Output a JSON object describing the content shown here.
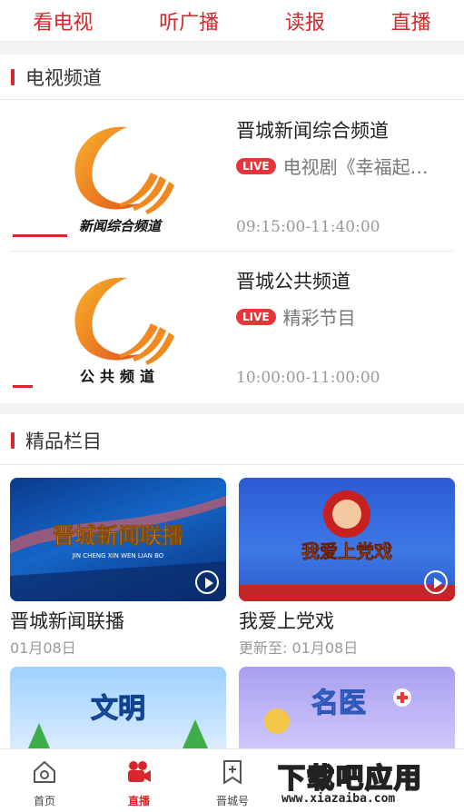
{
  "top_tabs": [
    "看电视",
    "听广播",
    "读报",
    "直播"
  ],
  "sections": {
    "tv_channels": "电视频道",
    "premium_columns": "精品栏目"
  },
  "channels": [
    {
      "logo_text": "新闻综合频道",
      "name": "晋城新闻综合频道",
      "live_badge": "LIVE",
      "program": "电视剧《幸福起…",
      "time": "09:15:00-11:40:00"
    },
    {
      "logo_text": "公共频道",
      "name": "晋城公共频道",
      "live_badge": "LIVE",
      "program": "精彩节目",
      "time": "10:00:00-11:00:00"
    }
  ],
  "columns": [
    {
      "title": "晋城新闻联播",
      "date": "01月08日",
      "thumb_text": "晋城新闻联播",
      "thumb_sub": "JIN CHENG XIN WEN LIAN BO"
    },
    {
      "title": "我爱上党戏",
      "date": "更新至:  01月08日",
      "thumb_text": "我爱上党戏"
    },
    {
      "title": "",
      "date": "",
      "thumb_text": "文明"
    },
    {
      "title": "",
      "date": "",
      "thumb_text": "名医"
    }
  ],
  "bottom_nav": [
    {
      "label": "首页",
      "icon": "home-icon"
    },
    {
      "label": "直播",
      "icon": "camera-icon"
    },
    {
      "label": "晋城号",
      "icon": "bookmark-icon"
    }
  ],
  "watermark": {
    "main": "下载吧应用",
    "url": "www.xiazaiba.com"
  },
  "colors": {
    "accent": "#d7262c",
    "live": "#e8353b"
  }
}
